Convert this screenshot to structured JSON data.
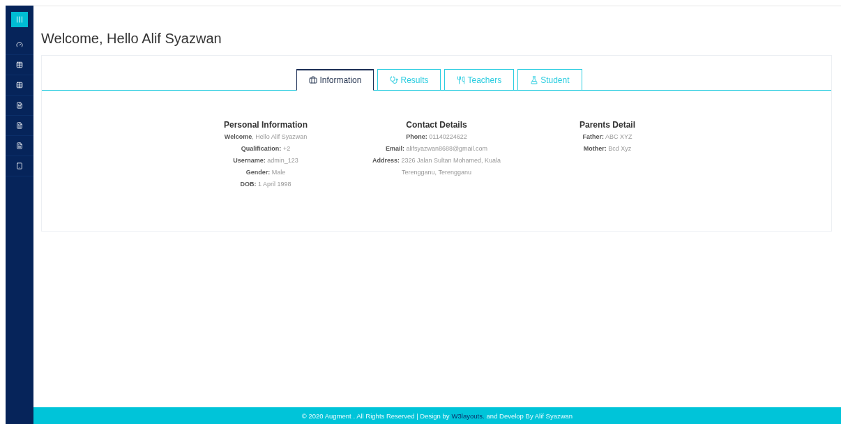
{
  "page": {
    "title": "Welcome, Hello Alif Syazwan"
  },
  "tabs": [
    {
      "label": "Information",
      "kind": "briefcase",
      "selected": true
    },
    {
      "label": "Results",
      "kind": "stethoscope",
      "selected": false
    },
    {
      "label": "Teachers",
      "kind": "utensils",
      "selected": false
    },
    {
      "label": "Student",
      "kind": "flask",
      "selected": false
    }
  ],
  "sections": [
    {
      "heading": "Personal Information",
      "lines": [
        "**Welcome**, Hello Alif Syazwan",
        "**Qualification:** +2",
        "**Username:** admin_123",
        "**Gender:** Male",
        "**DOB:** 1 April 1998"
      ]
    },
    {
      "heading": "Contact Details",
      "lines": [
        "**Phone:** 01140224622",
        "**Email:** alifsyazwan8688@gmail.com",
        "**Address:** 2326 Jalan Sultan Mohamed, Kuala Terengganu, Terengganu"
      ]
    },
    {
      "heading": "Parents Detail",
      "lines": [
        "**Father:** ABC XYZ",
        "**Mother:** Bcd Xyz"
      ]
    }
  ],
  "footer": {
    "before": "© 2020 Augment . All Rights Reserved | Design by",
    "link": "W3layouts.",
    "after": "and Develop By Alif Syazwan"
  }
}
